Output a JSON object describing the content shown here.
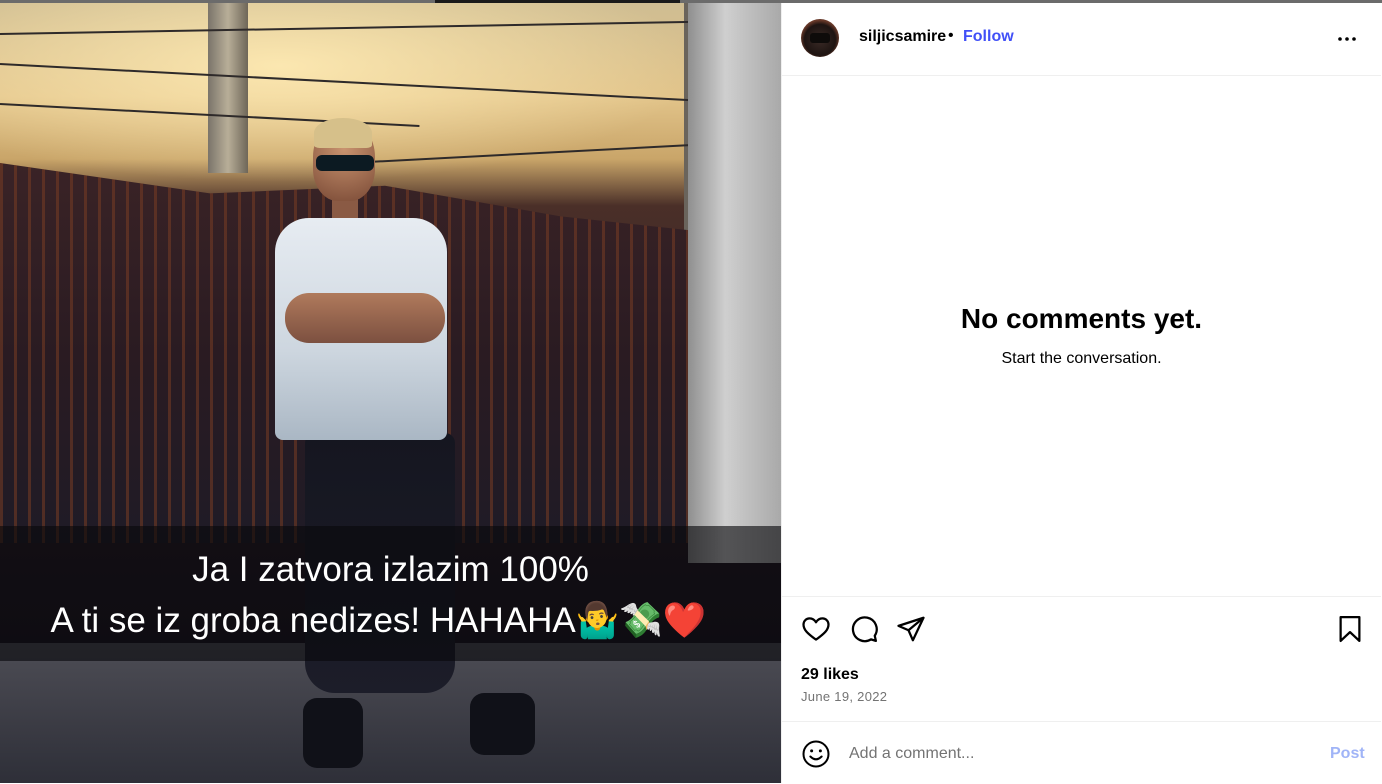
{
  "post": {
    "caption_line_1": "Ja I zatvora izlazim 100%",
    "caption_line_2": "A ti se iz groba nedizes!  HAHAHA🤷‍♂️💸❤️"
  },
  "header": {
    "username": "siljicsamire",
    "separator": "•",
    "follow_label": "Follow"
  },
  "comments": {
    "empty_title": "No comments yet.",
    "empty_subtitle": "Start the conversation."
  },
  "stats": {
    "likes": "29 likes",
    "date": "June 19, 2022"
  },
  "comment_bar": {
    "placeholder": "Add a comment...",
    "post_label": "Post"
  },
  "colors": {
    "follow": "#4150f7",
    "post_disabled": "#a0b4f7",
    "secondary_text": "#737373"
  },
  "icons": [
    "more-icon",
    "heart-icon",
    "comment-icon",
    "share-icon",
    "bookmark-icon",
    "emoji-icon"
  ]
}
